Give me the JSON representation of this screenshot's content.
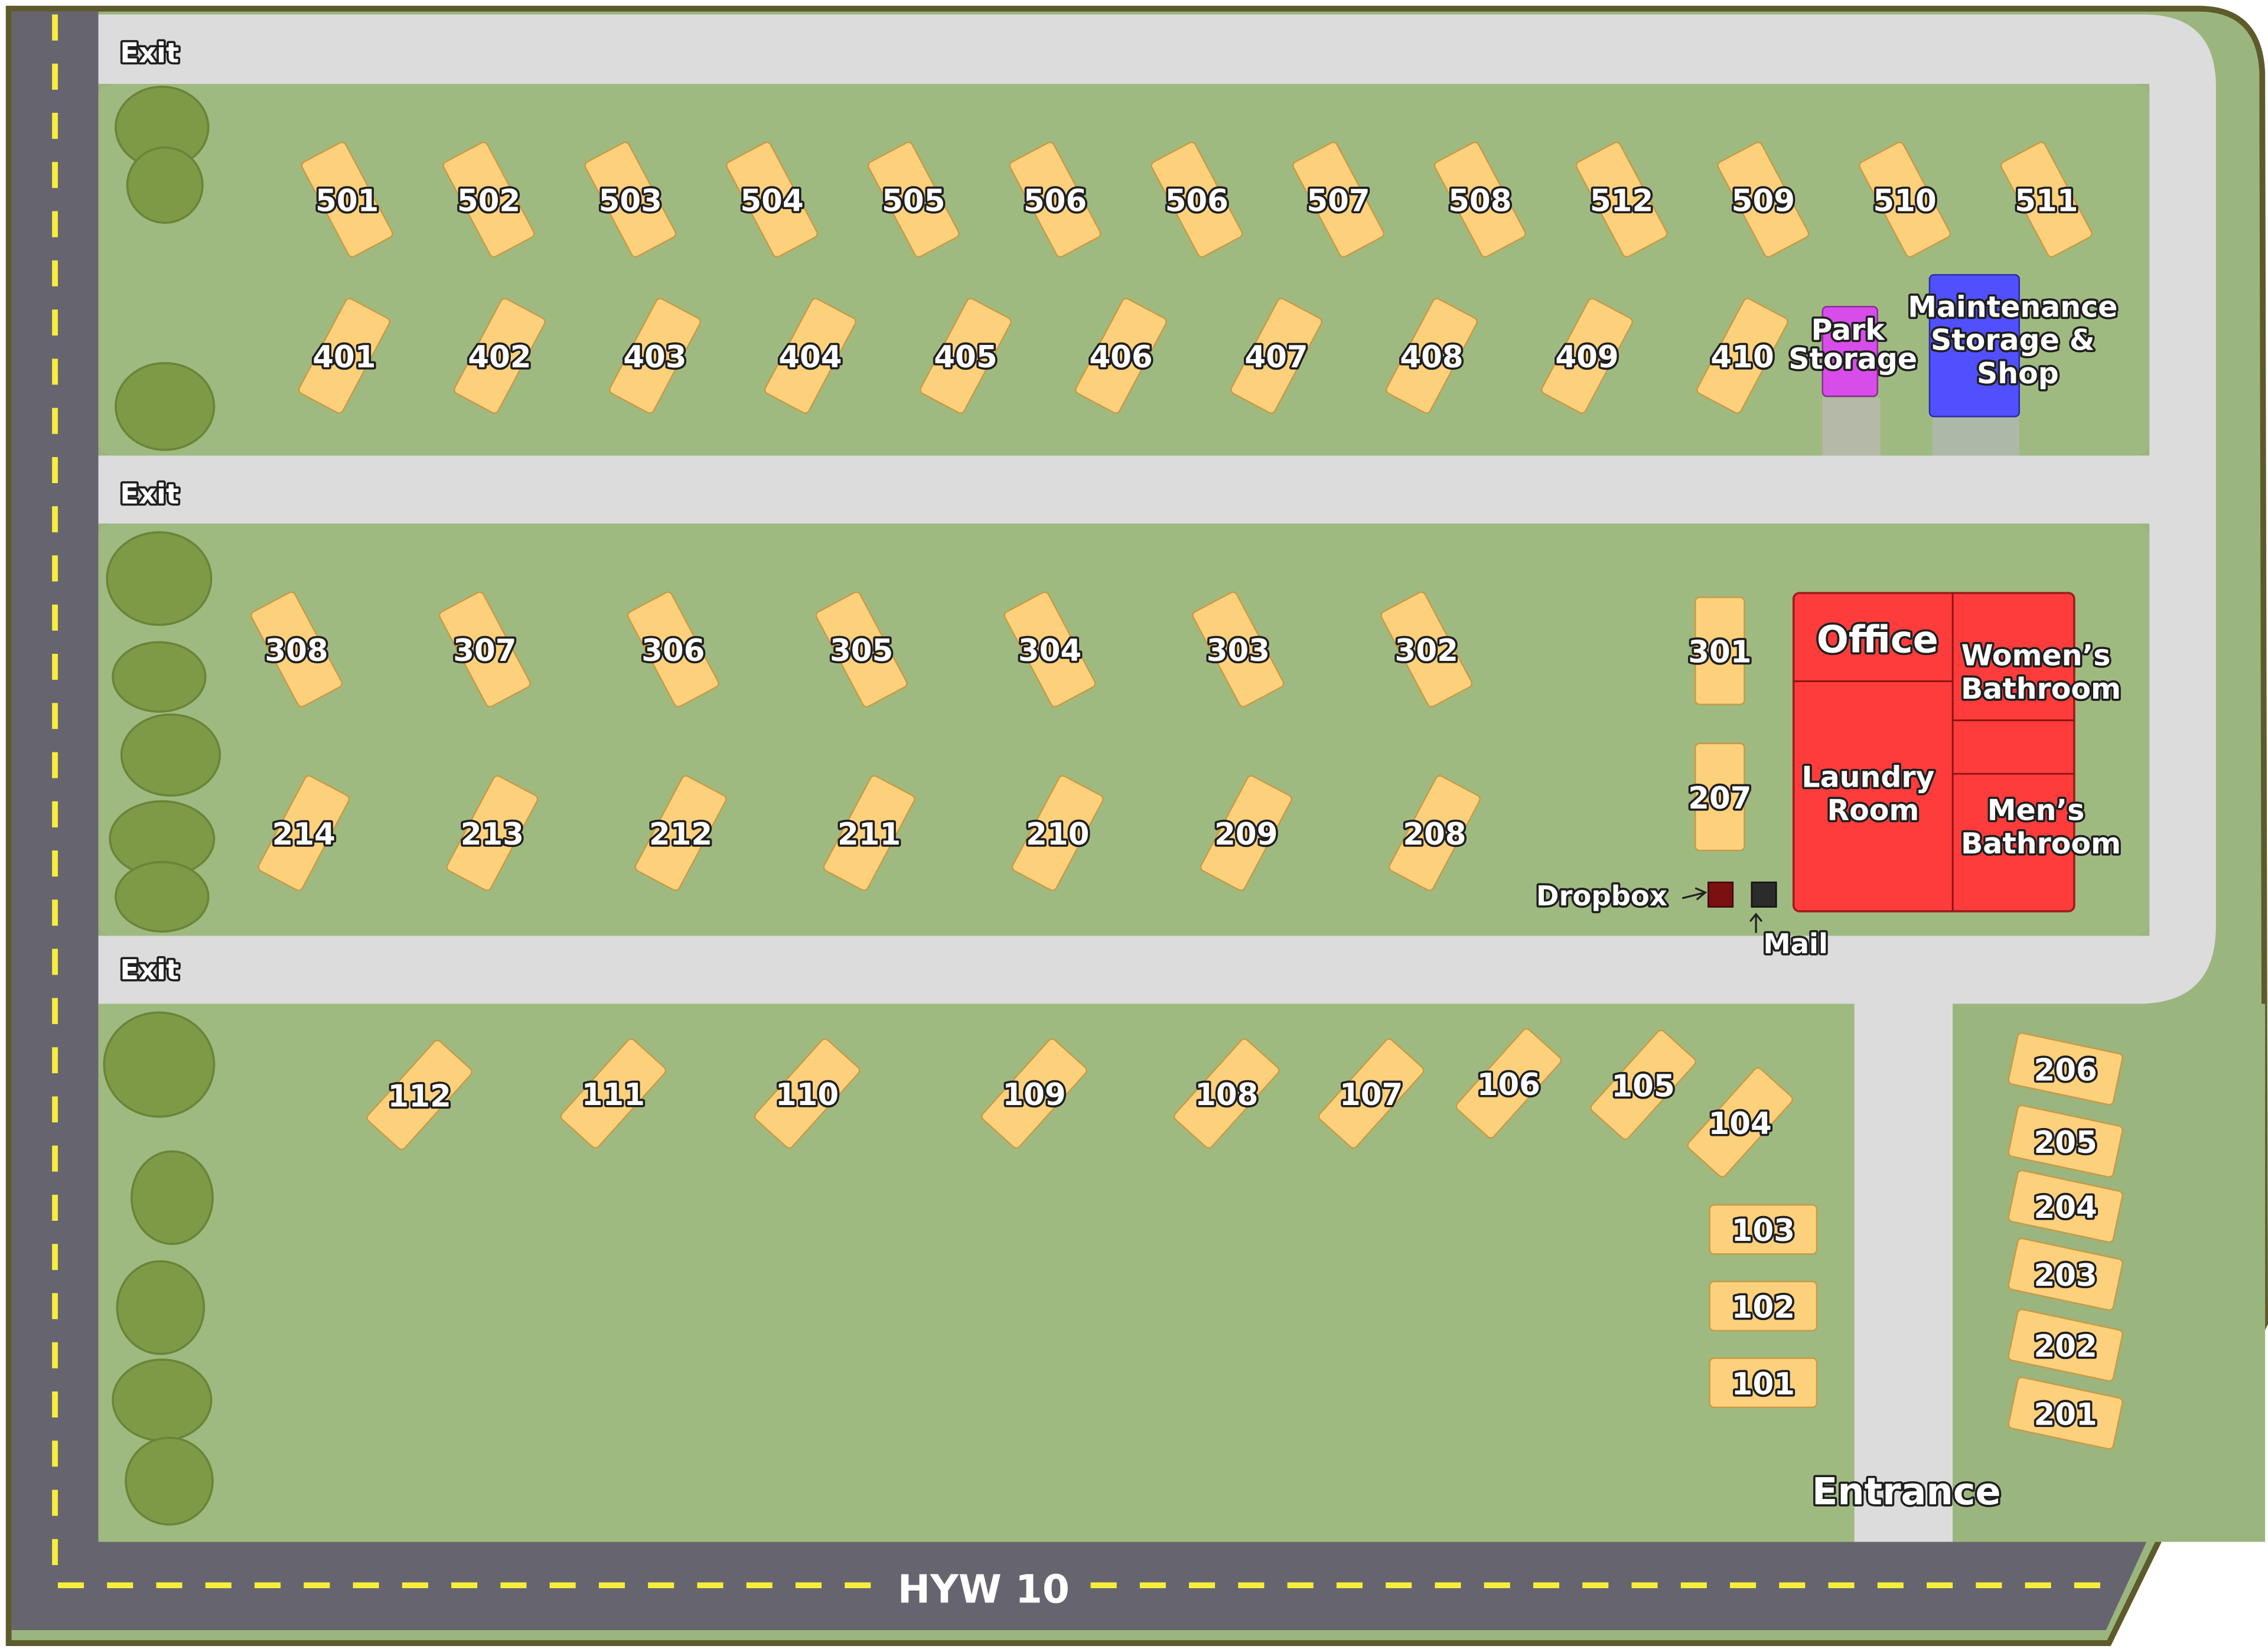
{
  "colors": {
    "grass_outer": "#9bb57e",
    "grass_lot": "#9fba80",
    "road": "#66656f",
    "road_stripe": "#f7ee3c",
    "lane": "#dcdcdc",
    "lot": "#fdd07c",
    "office": "#ff3c3c",
    "park_storage": "#d84dea",
    "maintenance": "#5050ff",
    "tree": "#7f9a47"
  },
  "labels": {
    "exits": [
      "Exit",
      "Exit",
      "Exit"
    ],
    "highway": "HYW 10",
    "entrance": "Entrance",
    "park_storage_line1": "Park",
    "park_storage_line2": "Storage",
    "maint_line1": "Maintenance",
    "maint_line2": "Storage &",
    "maint_line3": "Shop",
    "office": "Office",
    "womens_line1": "Women’s",
    "womens_line2": "Bathroom",
    "laundry_line1": "Laundry",
    "laundry_line2": "Room",
    "mens_line1": "Men’s",
    "mens_line2": "Bathroom",
    "dropbox": "Dropbox",
    "mail": "Mail"
  },
  "lots": {
    "row500": [
      "501",
      "502",
      "503",
      "504",
      "505",
      "506",
      "506",
      "507",
      "508",
      "512",
      "509",
      "510",
      "511"
    ],
    "row400": [
      "401",
      "402",
      "403",
      "404",
      "405",
      "406",
      "407",
      "408",
      "409",
      "410"
    ],
    "row300": [
      "308",
      "307",
      "306",
      "305",
      "304",
      "303",
      "302",
      "301"
    ],
    "row200": [
      "214",
      "213",
      "212",
      "211",
      "210",
      "209",
      "208",
      "207"
    ],
    "row100": [
      "112",
      "111",
      "110",
      "109",
      "108",
      "107",
      "106",
      "105",
      "104",
      "103",
      "102",
      "101"
    ],
    "row200_east": [
      "206",
      "205",
      "204",
      "203",
      "202",
      "201"
    ]
  }
}
